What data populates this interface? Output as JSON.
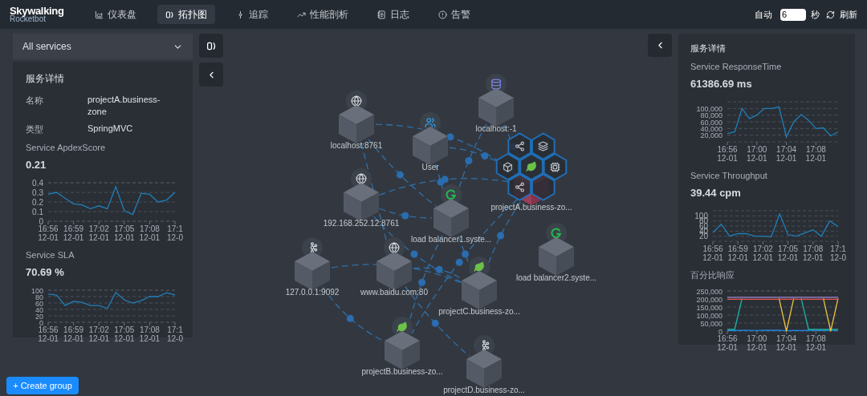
{
  "header": {
    "logo_top": "Skywalking",
    "logo_bottom": "Rocketbot",
    "nav": [
      {
        "label": "仪表盘",
        "selected": false
      },
      {
        "label": "拓扑图",
        "selected": true
      },
      {
        "label": "追踪",
        "selected": false
      },
      {
        "label": "性能剖析",
        "selected": false
      },
      {
        "label": "日志",
        "selected": false
      },
      {
        "label": "告警",
        "selected": false
      }
    ],
    "auto_label": "自动",
    "interval": "6",
    "unit": "秒",
    "refresh": "刷新"
  },
  "left_panel": {
    "service_select": "All services",
    "title": "服务详情",
    "fields": [
      {
        "label": "名称",
        "value": "projectA.business-zone"
      },
      {
        "label": "类型",
        "value": "SpringMVC"
      }
    ],
    "metrics": [
      {
        "title": "Service ApdexScore",
        "value": "0.21",
        "chart_data": {
          "type": "line",
          "grid": true,
          "ylim": [
            0,
            0.4
          ],
          "yticks": [
            0,
            0.1,
            0.2,
            0.3,
            0.4
          ],
          "categories": [
            "16:56\n12-01",
            null,
            null,
            "16:59\n12-01",
            null,
            null,
            "17:02\n12-01",
            null,
            null,
            "17:05\n12-01",
            null,
            null,
            "17:08\n12-01",
            null,
            null,
            "17:1\n12-0"
          ],
          "series": [
            {
              "color": "#1f7fb8",
              "values": [
                0.28,
                0.3,
                0.24,
                0.18,
                0.17,
                0.13,
                0.16,
                0.13,
                0.36,
                0.11,
                0.07,
                0.29,
                0.28,
                0.2,
                0.22,
                0.3
              ]
            }
          ]
        }
      },
      {
        "title": "Service SLA",
        "value": "70.69 %",
        "chart_data": {
          "type": "line",
          "grid": true,
          "ylim": [
            0,
            100
          ],
          "yticks": [
            0,
            20,
            40,
            60,
            80,
            100
          ],
          "categories": [
            "16:56\n12-01",
            null,
            null,
            "16:59\n12-01",
            null,
            null,
            "17:02\n12-01",
            null,
            null,
            "17:05\n12-01",
            null,
            null,
            "17:08\n12-01",
            null,
            null,
            "17:1\n12-0"
          ],
          "series": [
            {
              "color": "#1f7fb8",
              "values": [
                88,
                85,
                52,
                65,
                62,
                52,
                52,
                43,
                93,
                70,
                60,
                67,
                80,
                80,
                92,
                85
              ]
            }
          ]
        }
      }
    ]
  },
  "create_group": "+ Create group",
  "topology": {
    "nodes": [
      {
        "label": "localhost:8761",
        "kind": "globe",
        "selected": false
      },
      {
        "label": "User",
        "kind": "users",
        "selected": false
      },
      {
        "label": "localhost:-1",
        "kind": "database",
        "selected": false
      },
      {
        "label": "192.168.252.12:8761",
        "kind": "globe",
        "selected": false
      },
      {
        "label": "load balancer1.syste...",
        "kind": "gateway",
        "selected": false
      },
      {
        "label": "projectA.business-zo...",
        "kind": "spring",
        "selected": true
      },
      {
        "label": "load balancer2.syste...",
        "kind": "gateway",
        "selected": false
      },
      {
        "label": "127.0.0.1:9092",
        "kind": "kafka",
        "selected": false
      },
      {
        "label": "www.baidu.com:80",
        "kind": "globe",
        "selected": false
      },
      {
        "label": "projectC.business-zo...",
        "kind": "spring",
        "selected": false
      },
      {
        "label": "projectB.business-zo...",
        "kind": "spring",
        "selected": false
      },
      {
        "label": "projectD.business-zo...",
        "kind": "kafka",
        "selected": false
      }
    ]
  },
  "right_panel": {
    "title": "服务详情",
    "metrics": [
      {
        "title": "Service ResponseTime",
        "value": "61386.69 ms",
        "chart_data": {
          "type": "line",
          "grid": true,
          "ylim": [
            0,
            120000
          ],
          "yticks": [
            {
              "value": 20000,
              "label": "20,000"
            },
            {
              "value": 40000,
              "label": "40,000"
            },
            {
              "value": 60000,
              "label": "60,000"
            },
            {
              "value": 80000,
              "label": "80,000"
            },
            {
              "value": 100000,
              "label": "100,000"
            }
          ],
          "categories": [
            "16:56\n12-01",
            null,
            null,
            null,
            "17:00\n12-01",
            null,
            null,
            null,
            "17:04\n12-01",
            null,
            null,
            null,
            "17:08\n12-01",
            null,
            null,
            null
          ],
          "series": [
            {
              "color": "#1f7fb8",
              "values": [
                25000,
                30000,
                100000,
                70000,
                80000,
                100000,
                100000,
                105000,
                15000,
                60000,
                82000,
                65000,
                40000,
                42000,
                18000,
                30000
              ]
            }
          ]
        }
      },
      {
        "title": "Service Throughput",
        "value": "39.44 cpm",
        "chart_data": {
          "type": "line",
          "grid": true,
          "ylim": [
            0,
            120
          ],
          "yticks": [
            20,
            40,
            60,
            80,
            100
          ],
          "categories": [
            "16:56\n12-01",
            null,
            null,
            "16:59\n12-01",
            null,
            null,
            "17:02\n12-01",
            null,
            null,
            "17:05\n12-01",
            null,
            null,
            "17:08\n12-01",
            null,
            null,
            "17:1\n12-0"
          ],
          "series": [
            {
              "color": "#1f7fb8",
              "values": [
                34,
                68,
                20,
                30,
                30,
                20,
                20,
                18,
                108,
                26,
                20,
                33,
                45,
                20,
                80,
                58
              ]
            }
          ]
        }
      },
      {
        "title": "百分比响应",
        "chart_data": {
          "type": "line",
          "grid": true,
          "ylim": [
            0,
            250000
          ],
          "yticks": [
            {
              "value": 0,
              "label": "0"
            },
            {
              "value": 50000,
              "label": "50,000"
            },
            {
              "value": 100000,
              "label": "100,000"
            },
            {
              "value": 150000,
              "label": "150,000"
            },
            {
              "value": 200000,
              "label": "200,000"
            },
            {
              "value": 250000,
              "label": "250,000"
            }
          ],
          "categories": [
            "16:56\n12-01",
            null,
            null,
            null,
            "17:00\n12-01",
            null,
            null,
            null,
            "17:04\n12-01",
            null,
            null,
            null,
            "17:08\n12-01",
            null,
            null,
            null
          ],
          "series": [
            {
              "color": "#1e88e5",
              "values": [
                3000,
                3000,
                5000,
                4000,
                3000,
                6000,
                5000,
                6000,
                2000,
                4000,
                3000,
                5000,
                4000,
                3000,
                4000,
                4000
              ]
            },
            {
              "color": "#20b2aa",
              "values": [
                10000,
                10000,
                204000,
                null,
                null,
                null,
                null,
                null,
                null,
                null,
                204000,
                10000,
                10000,
                10000,
                10000,
                10000
              ]
            },
            {
              "color": "#f0c040",
              "values": [
                null,
                null,
                null,
                null,
                null,
                null,
                null,
                204000,
                0,
                204000,
                null,
                null,
                null,
                204000,
                0,
                204000
              ]
            },
            {
              "color": "#e5534b",
              "values": [
                198000,
                198000,
                198000,
                198000,
                198000,
                198000,
                198000,
                198000,
                198000,
                198000,
                198000,
                198000,
                198000,
                198000,
                198000,
                198000
              ]
            },
            {
              "color": "#a58bd8",
              "values": [
                211000,
                211000,
                211000,
                211000,
                211000,
                211000,
                211000,
                211000,
                211000,
                211000,
                211000,
                211000,
                211000,
                211000,
                211000,
                211000
              ]
            }
          ]
        }
      }
    ]
  }
}
